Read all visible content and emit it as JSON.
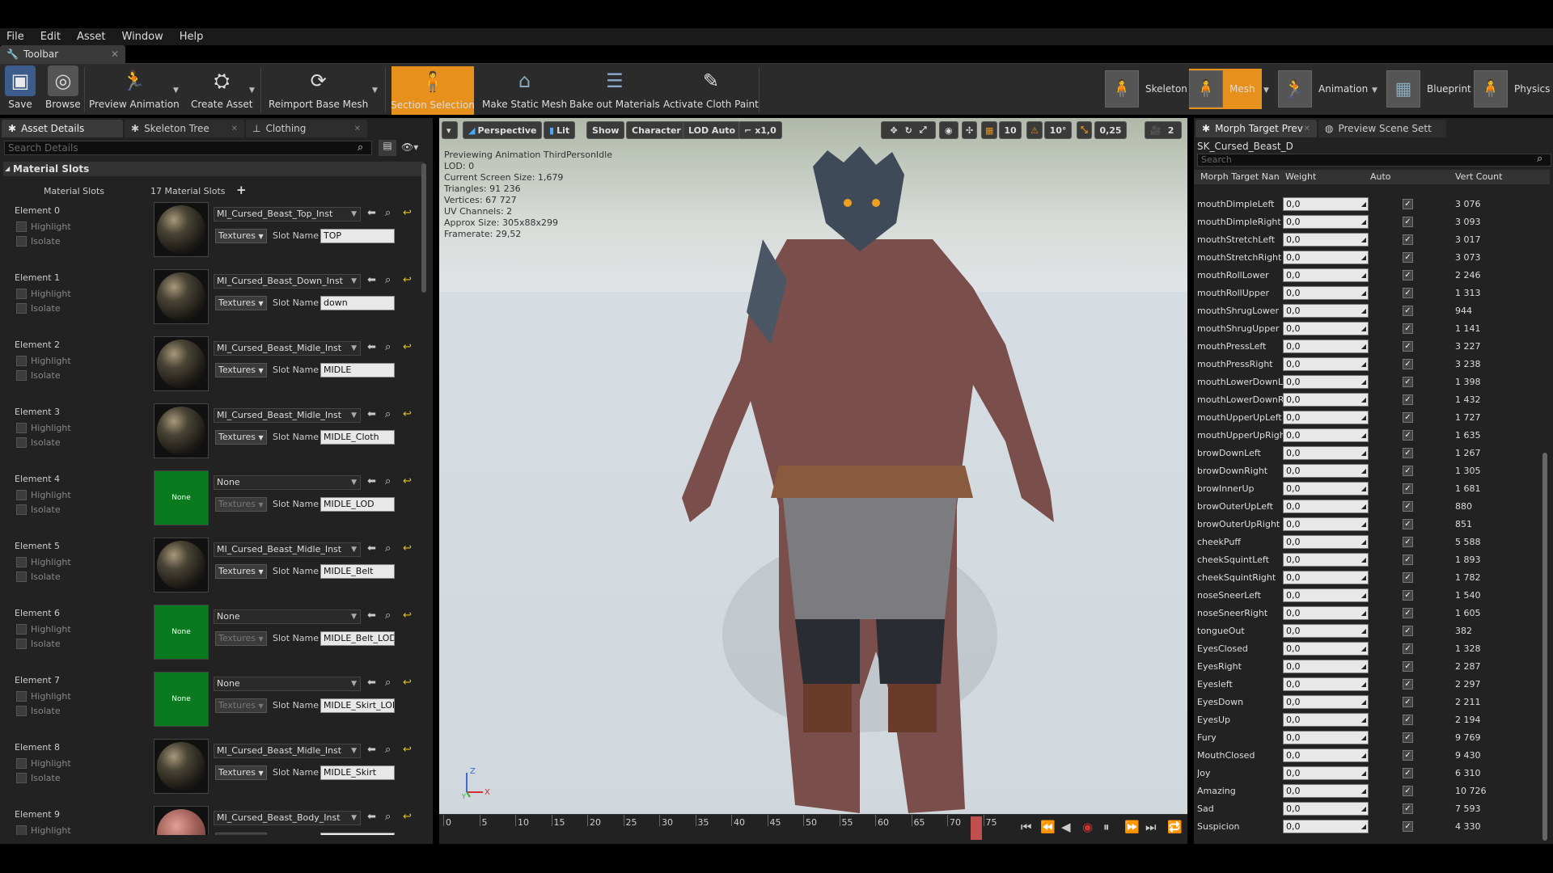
{
  "menu": [
    "File",
    "Edit",
    "Asset",
    "Window",
    "Help"
  ],
  "toolbar_tab": "Toolbar",
  "toolbar": {
    "buttons": [
      {
        "label": "Save",
        "icon": "save-icon"
      },
      {
        "label": "Browse",
        "icon": "browse-icon"
      },
      {
        "label": "Preview Animation",
        "icon": "preview-animation-icon"
      },
      {
        "label": "Create Asset",
        "icon": "create-asset-icon"
      },
      {
        "label": "Reimport Base Mesh",
        "icon": "reimport-icon"
      },
      {
        "label": "Section Selection",
        "icon": "section-selection-icon",
        "active": true
      },
      {
        "label": "Make Static Mesh",
        "icon": "static-mesh-icon"
      },
      {
        "label": "Bake out Materials",
        "icon": "bake-materials-icon"
      },
      {
        "label": "Activate Cloth Paint",
        "icon": "cloth-paint-icon"
      }
    ],
    "modes": [
      {
        "label": "Skeleton",
        "icon": "skeleton-mode-icon"
      },
      {
        "label": "Mesh",
        "icon": "mesh-mode-icon",
        "active": true
      },
      {
        "label": "Animation",
        "icon": "animation-mode-icon"
      },
      {
        "label": "Blueprint",
        "icon": "blueprint-mode-icon"
      },
      {
        "label": "Physics",
        "icon": "physics-mode-icon"
      }
    ],
    "active_color": "#e8901c"
  },
  "left": {
    "tabs": [
      "Asset Details",
      "Skeleton Tree",
      "Clothing"
    ],
    "search_placeholder": "Search Details",
    "section": "Material Slots",
    "slots_label": "Material Slots",
    "slots_count": "17 Material Slots",
    "highlight": "Highlight",
    "isolate": "Isolate",
    "textures": "Textures",
    "slot_name_label": "Slot Name",
    "elements": [
      {
        "name": "Element 0",
        "material": "MI_Cursed_Beast_Top_Inst",
        "slot": "TOP",
        "thumb": "sphere"
      },
      {
        "name": "Element 1",
        "material": "MI_Cursed_Beast_Down_Inst",
        "slot": "down",
        "thumb": "sphere"
      },
      {
        "name": "Element 2",
        "material": "MI_Cursed_Beast_Midle_Inst",
        "slot": "MIDLE",
        "thumb": "sphere"
      },
      {
        "name": "Element 3",
        "material": "MI_Cursed_Beast_Midle_Inst",
        "slot": "MIDLE_Cloth",
        "thumb": "sphere"
      },
      {
        "name": "Element 4",
        "material": "None",
        "slot": "MIDLE_LOD",
        "thumb": "none"
      },
      {
        "name": "Element 5",
        "material": "MI_Cursed_Beast_Midle_Inst",
        "slot": "MIDLE_Belt",
        "thumb": "sphere"
      },
      {
        "name": "Element 6",
        "material": "None",
        "slot": "MIDLE_Belt_LOD",
        "thumb": "none"
      },
      {
        "name": "Element 7",
        "material": "None",
        "slot": "MIDLE_Skirt_LOD",
        "thumb": "none"
      },
      {
        "name": "Element 8",
        "material": "MI_Cursed_Beast_Midle_Inst",
        "slot": "MIDLE_Skirt",
        "thumb": "sphere"
      },
      {
        "name": "Element 9",
        "material": "MI_Cursed_Beast_Body_Inst",
        "slot": "",
        "thumb": "skin"
      }
    ],
    "none_label": "None"
  },
  "viewport": {
    "buttons": {
      "perspective": "Perspective",
      "lit": "Lit",
      "show": "Show",
      "character": "Character",
      "lod": "LOD Auto",
      "speed": "x1,0",
      "grid": "10",
      "angle": "10°",
      "scale": "0,25",
      "cam": "2"
    },
    "info": [
      "Previewing Animation ThirdPersonIdle",
      "LOD: 0",
      "Current Screen Size: 1,679",
      "Triangles: 91 236",
      "Vertices: 67 727",
      "UV Channels: 2",
      "Approx Size: 305x88x299",
      "Framerate: 29,52"
    ],
    "timeline_ticks": [
      "0",
      "5",
      "10",
      "15",
      "20",
      "25",
      "30",
      "35",
      "40",
      "45",
      "50",
      "55",
      "60",
      "65",
      "70",
      "75"
    ],
    "axis": {
      "z": "Z",
      "x": "X",
      "y": "Y"
    }
  },
  "right": {
    "tabs": [
      "Morph Target Prev",
      "Preview Scene Sett"
    ],
    "mesh_name": "SK_Cursed_Beast_D",
    "search_placeholder": "Search",
    "headers": {
      "name": "Morph Target Nan",
      "weight": "Weight",
      "auto": "Auto",
      "vert": "Vert Count"
    },
    "rows": [
      {
        "name": "mouthDimpleLeft",
        "weight": "0,0",
        "vert": "3 076"
      },
      {
        "name": "mouthDimpleRight",
        "weight": "0,0",
        "vert": "3 093"
      },
      {
        "name": "mouthStretchLeft",
        "weight": "0,0",
        "vert": "3 017"
      },
      {
        "name": "mouthStretchRight",
        "weight": "0,0",
        "vert": "3 073"
      },
      {
        "name": "mouthRollLower",
        "weight": "0,0",
        "vert": "2 246"
      },
      {
        "name": "mouthRollUpper",
        "weight": "0,0",
        "vert": "1 313"
      },
      {
        "name": "mouthShrugLower",
        "weight": "0,0",
        "vert": "944"
      },
      {
        "name": "mouthShrugUpper",
        "weight": "0,0",
        "vert": "1 141"
      },
      {
        "name": "mouthPressLeft",
        "weight": "0,0",
        "vert": "3 227"
      },
      {
        "name": "mouthPressRight",
        "weight": "0,0",
        "vert": "3 238"
      },
      {
        "name": "mouthLowerDownL",
        "weight": "0,0",
        "vert": "1 398"
      },
      {
        "name": "mouthLowerDownR",
        "weight": "0,0",
        "vert": "1 432"
      },
      {
        "name": "mouthUpperUpLeft",
        "weight": "0,0",
        "vert": "1 727"
      },
      {
        "name": "mouthUpperUpRight",
        "weight": "0,0",
        "vert": "1 635"
      },
      {
        "name": "browDownLeft",
        "weight": "0,0",
        "vert": "1 267"
      },
      {
        "name": "browDownRight",
        "weight": "0,0",
        "vert": "1 305"
      },
      {
        "name": "browInnerUp",
        "weight": "0,0",
        "vert": "1 681"
      },
      {
        "name": "browOuterUpLeft",
        "weight": "0,0",
        "vert": "880"
      },
      {
        "name": "browOuterUpRight",
        "weight": "0,0",
        "vert": "851"
      },
      {
        "name": "cheekPuff",
        "weight": "0,0",
        "vert": "5 588"
      },
      {
        "name": "cheekSquintLeft",
        "weight": "0,0",
        "vert": "1 893"
      },
      {
        "name": "cheekSquintRight",
        "weight": "0,0",
        "vert": "1 782"
      },
      {
        "name": "noseSneerLeft",
        "weight": "0,0",
        "vert": "1 540"
      },
      {
        "name": "noseSneerRight",
        "weight": "0,0",
        "vert": "1 605"
      },
      {
        "name": "tongueOut",
        "weight": "0,0",
        "vert": "382"
      },
      {
        "name": "EyesClosed",
        "weight": "0,0",
        "vert": "1 328"
      },
      {
        "name": "EyesRight",
        "weight": "0,0",
        "vert": "2 287"
      },
      {
        "name": "Eyesleft",
        "weight": "0,0",
        "vert": "2 297"
      },
      {
        "name": "EyesDown",
        "weight": "0,0",
        "vert": "2 211"
      },
      {
        "name": "EyesUp",
        "weight": "0,0",
        "vert": "2 194"
      },
      {
        "name": "Fury",
        "weight": "0,0",
        "vert": "9 769"
      },
      {
        "name": "MouthClosed",
        "weight": "0,0",
        "vert": "9 430"
      },
      {
        "name": "Joy",
        "weight": "0,0",
        "vert": "6 310"
      },
      {
        "name": "Amazing",
        "weight": "0,0",
        "vert": "10 726"
      },
      {
        "name": "Sad",
        "weight": "0,0",
        "vert": "7 593"
      },
      {
        "name": "Suspicion",
        "weight": "0,0",
        "vert": "4 330"
      }
    ]
  }
}
